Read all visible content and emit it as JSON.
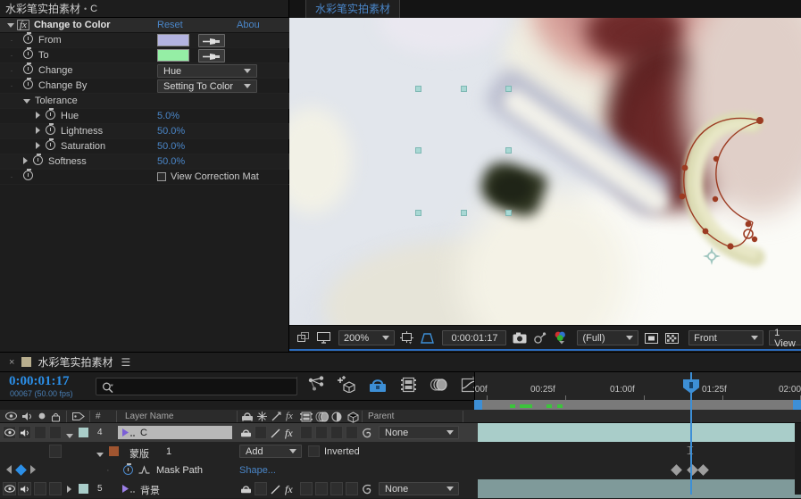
{
  "effect_controls": {
    "panel_title": "水彩笔实拍素材",
    "separator": "•",
    "layer_name": "C",
    "effect": {
      "name": "Change to Color",
      "fx_badge": "fx",
      "reset_label": "Reset",
      "about_label": "Abou"
    },
    "properties": [
      {
        "label": "From",
        "type": "color",
        "color": "#b3b3e0"
      },
      {
        "label": "To",
        "type": "color",
        "color": "#95eea5"
      },
      {
        "label": "Change",
        "type": "dropdown",
        "value": "Hue"
      },
      {
        "label": "Change By",
        "type": "dropdown",
        "value": "Setting To Color"
      }
    ],
    "tolerance_group": {
      "label": "Tolerance",
      "items": [
        {
          "label": "Hue",
          "value": "5.0",
          "unit": "%"
        },
        {
          "label": "Lightness",
          "value": "50.0",
          "unit": "%"
        },
        {
          "label": "Saturation",
          "value": "50.0",
          "unit": "%"
        }
      ]
    },
    "softness": {
      "label": "Softness",
      "value": "50.0",
      "unit": "%"
    },
    "view_correction": {
      "label": "View Correction Mat",
      "checked": false
    }
  },
  "viewer": {
    "tab_label": "水彩笔实拍素材",
    "magnification": "200%",
    "timecode": "0:00:01:17",
    "resolution": "(Full)",
    "view_layout": "Front",
    "views_label": "1 View",
    "icons": {
      "main_comp": "comp-flowchart-icon",
      "always_preview": "monitor-icon",
      "region_of_interest": "roi-icon",
      "mask_shape": "mask-visibility-icon",
      "snapshot": "camera-icon",
      "show_snapshot": "show-snapshot-icon",
      "channels": "channels-icon",
      "transparency_grid": "transparency-grid-icon",
      "alpha": "alpha-icon"
    },
    "anchor_point": "anchor-point-icon",
    "selection_handles": 8
  },
  "timeline": {
    "tab": {
      "close": "×",
      "title": "水彩笔实拍素材",
      "menu": "☰"
    },
    "timecode": "0:00:01:17",
    "frame_info": "00067 (50.00 fps)",
    "search_placeholder": "",
    "ruler_labels": [
      ":00f",
      "00:25f",
      "01:00f",
      "01:25f",
      "02:00"
    ],
    "columns": {
      "label_tag": "tag-icon",
      "number": "#",
      "layer_name": "Layer Name",
      "parent": "Parent"
    },
    "layers": [
      {
        "index": "4",
        "name": "C",
        "selected": true,
        "label_color": "#a9cdc9",
        "expanded": true,
        "parent": "None",
        "bar_color": "#a9cdc9"
      },
      {
        "index": "5",
        "name": "背景",
        "selected": false,
        "label_color": "#a9cdc9",
        "expanded": false,
        "parent": "None",
        "bar_color": "#7f9a9a"
      }
    ],
    "mask": {
      "name": "蒙版",
      "number": "1",
      "mode": "Add",
      "inverted_label": "Inverted",
      "label_color": "#a05530",
      "property_name": "Mask Path",
      "property_value": "Shape..."
    },
    "keyframe_count": 3
  }
}
